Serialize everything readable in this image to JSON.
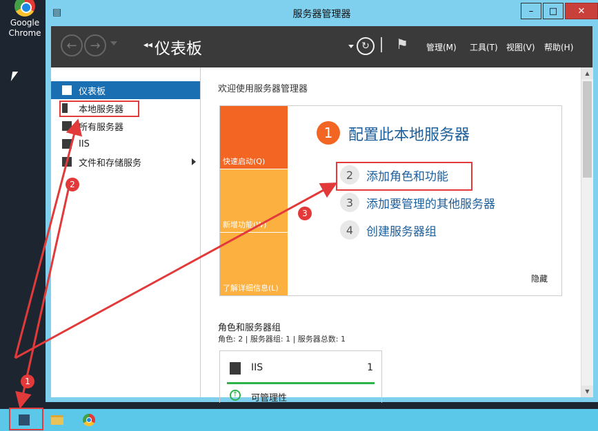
{
  "desktop": {
    "chrome_shortcut": "Google Chrome"
  },
  "window": {
    "title": "服务器管理器",
    "app_icon": "server-manager-icon",
    "controls": {
      "minimize": "–",
      "maximize": "□",
      "close": "✕"
    }
  },
  "toolbar": {
    "back_icon": "back-arrow-icon",
    "forward_icon": "forward-arrow-icon",
    "breadcrumb_arrows": "◂◂",
    "breadcrumb": "仪表板",
    "menus": [
      "管理(M)",
      "工具(T)",
      "视图(V)",
      "帮助(H)"
    ]
  },
  "sidebar": {
    "items": [
      {
        "label": "仪表板",
        "icon": "dashboard-icon",
        "active": true
      },
      {
        "label": "本地服务器",
        "icon": "server-icon"
      },
      {
        "label": "所有服务器",
        "icon": "servers-icon"
      },
      {
        "label": "IIS",
        "icon": "iis-icon"
      },
      {
        "label": "文件和存储服务",
        "icon": "storage-icon",
        "has_submenu": true
      }
    ]
  },
  "welcome": {
    "title": "欢迎使用服务器管理器",
    "tiles": [
      "快速启动(Q)",
      "新增功能(W)",
      "了解详细信息(L)"
    ],
    "step1": {
      "num": "1",
      "label": "配置此本地服务器"
    },
    "steps": [
      {
        "num": "2",
        "label": "添加角色和功能"
      },
      {
        "num": "3",
        "label": "添加要管理的其他服务器"
      },
      {
        "num": "4",
        "label": "创建服务器组"
      }
    ],
    "hide": "隐藏"
  },
  "roles": {
    "title": "角色和服务器组",
    "summary": "角色: 2 | 服务器组: 1 | 服务器总数: 1",
    "card": {
      "name": "IIS",
      "count": "1",
      "status": "可管理性"
    }
  },
  "annotations": [
    "1",
    "2",
    "3"
  ],
  "colors": {
    "accent_orange": "#f26522",
    "tile_light": "#fbb040",
    "link_blue": "#1d5f9c",
    "active_blue": "#1a6fb3",
    "annotation_red": "#e23a3a",
    "ok_green": "#2db34a"
  }
}
